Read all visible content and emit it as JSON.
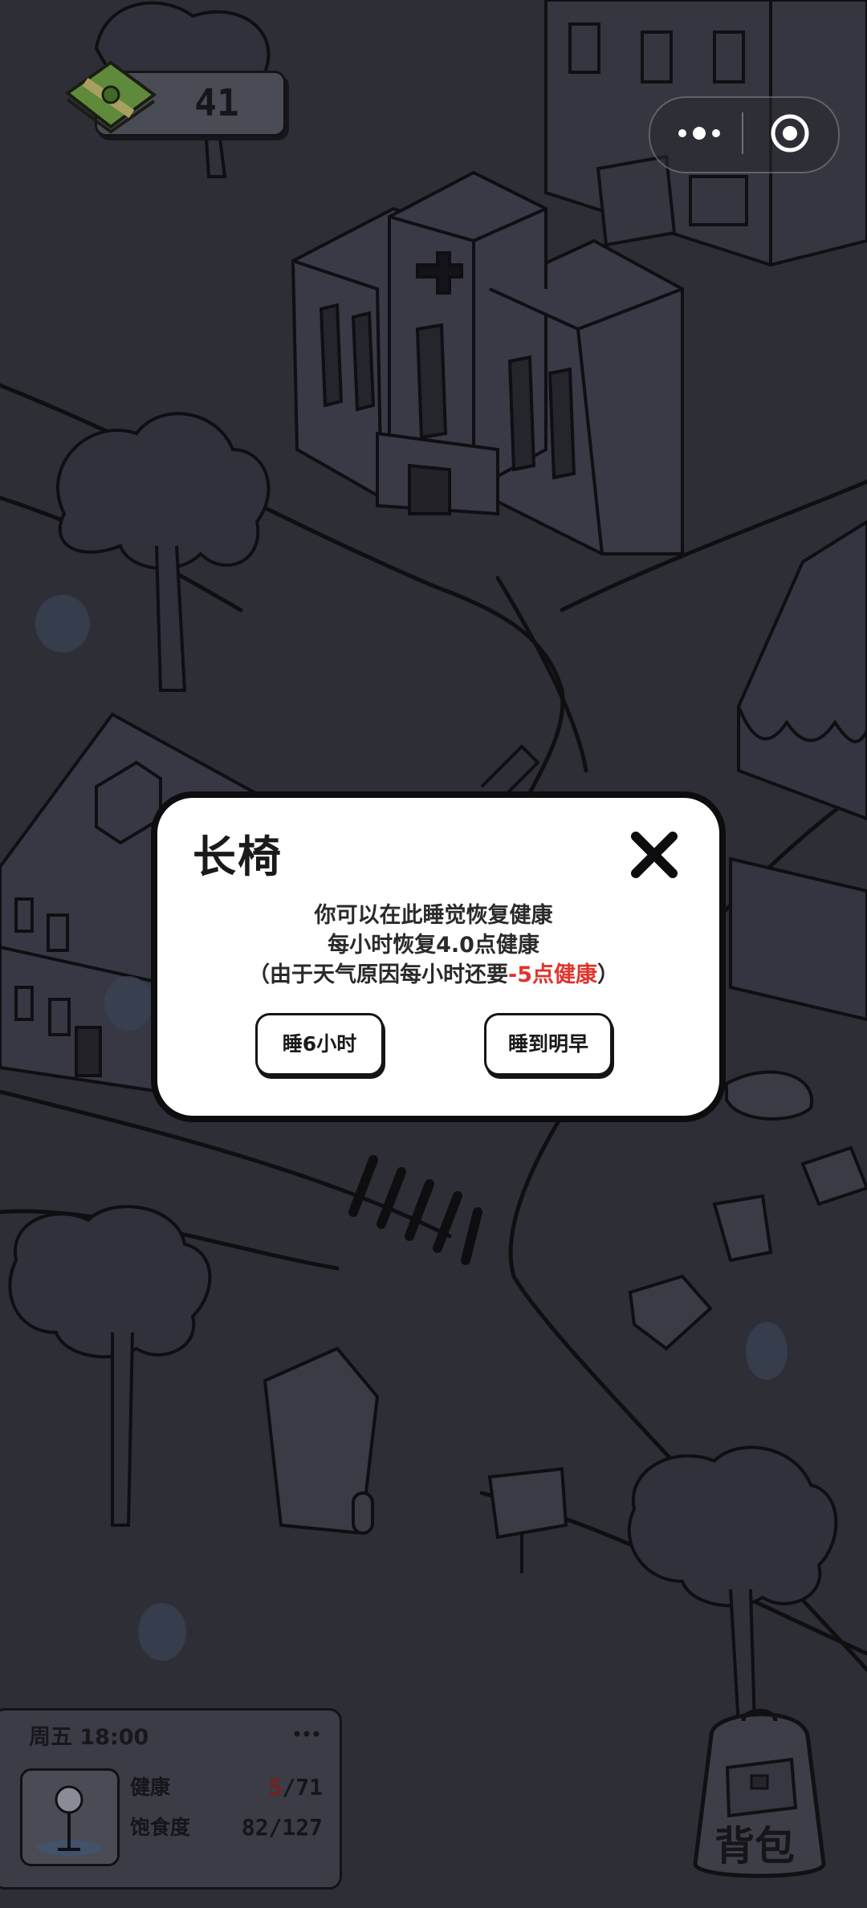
{
  "hud": {
    "money": "41"
  },
  "modal": {
    "title": "长椅",
    "line1": "你可以在此睡觉恢复健康",
    "line2": "每小时恢复4.0点健康",
    "line3_prefix": "（由于天气原因每小时还要",
    "line3_warn": "-5点健康",
    "line3_suffix": "）",
    "button_sleep6": "睡6小时",
    "button_sleep_morning": "睡到明早"
  },
  "status": {
    "day_time": "周五 18:00",
    "more": "···",
    "health_label": "健康",
    "health_current": "5",
    "health_max": "/71",
    "satiety_label": "饱食度",
    "satiety_value": "82/127"
  },
  "backpack": {
    "label": "背包"
  },
  "colors": {
    "background": "#2d2e36",
    "modal_bg": "#ffffff",
    "warning": "#e0342c",
    "outline": "#0d0d0f"
  },
  "icons": {
    "money": "cash-stack-icon",
    "more": "more-dots-icon",
    "capsule_close": "target-icon",
    "modal_close": "close-x-icon",
    "avatar": "character-avatar",
    "backpack": "backpack-icon"
  }
}
